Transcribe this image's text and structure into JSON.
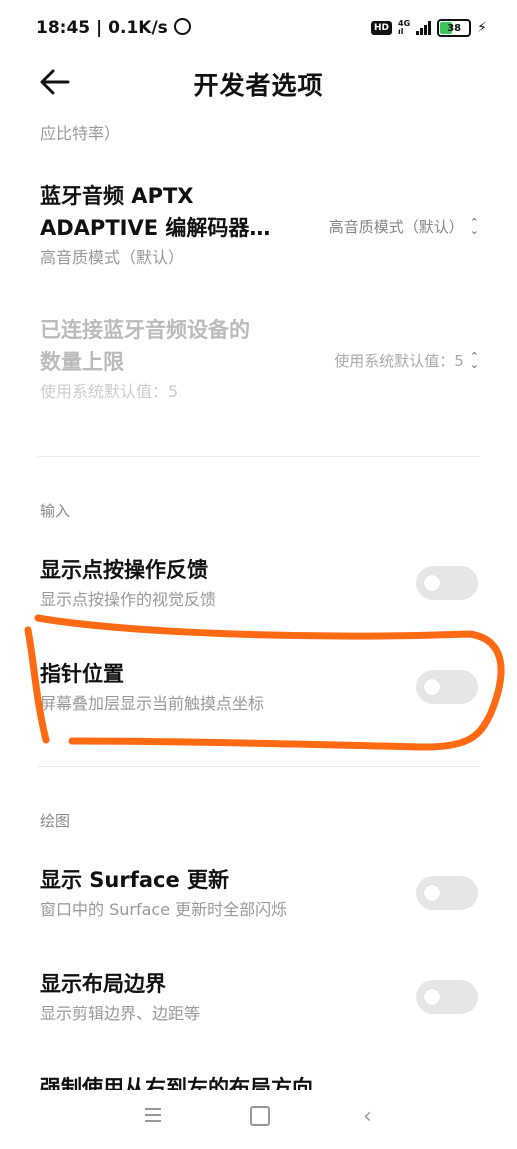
{
  "status": {
    "time_speed": "18:45 | 0.1K/s",
    "hd": "HD",
    "net_top": "4G",
    "net_bottom": "ıl",
    "battery": "38"
  },
  "header": {
    "title": "开发者选项"
  },
  "truncated_text": "应比特率）",
  "items": {
    "aptx": {
      "title_line1": "蓝牙音频 APTX",
      "title_line2": "ADAPTIVE 编解码器…",
      "subtitle": "高音质模式（默认）",
      "value": "高音质模式（默认）"
    },
    "bt_limit": {
      "title_line1": "已连接蓝牙音频设备的",
      "title_line2": "数量上限",
      "subtitle": "使用系统默认值：5",
      "value": "使用系统默认值：5"
    }
  },
  "sections": {
    "input": {
      "label": "输入",
      "show_taps": {
        "title": "显示点按操作反馈",
        "subtitle": "显示点按操作的视觉反馈",
        "enabled": false
      },
      "pointer": {
        "title": "指针位置",
        "subtitle": "屏幕叠加层显示当前触摸点坐标",
        "enabled": false
      }
    },
    "drawing": {
      "label": "绘图",
      "surface": {
        "title": "显示 Surface 更新",
        "subtitle": "窗口中的 Surface 更新时全部闪烁",
        "enabled": false
      },
      "layout_bounds": {
        "title": "显示布局边界",
        "subtitle": "显示剪辑边界、边距等",
        "enabled": false
      },
      "rtl": {
        "title": "强制使用从右到左的布局方向"
      }
    }
  },
  "colors": {
    "annotation": "#ff6a13",
    "toggle_off": "#e6e6e6"
  }
}
